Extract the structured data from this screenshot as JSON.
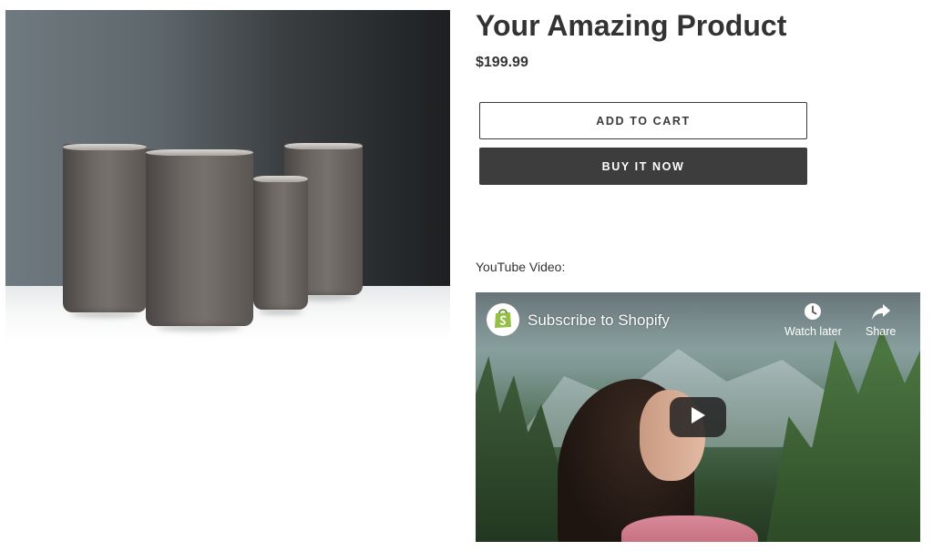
{
  "product": {
    "title": "Your Amazing Product",
    "price": "$199.99",
    "add_to_cart_label": "ADD TO CART",
    "buy_now_label": "BUY IT NOW"
  },
  "video_section": {
    "label": "YouTube Video:",
    "video_title": "Subscribe to Shopify",
    "watch_later_label": "Watch later",
    "share_label": "Share"
  },
  "icons": {
    "channel": "shopify-bag-icon",
    "watch_later": "clock-icon",
    "share": "share-arrow-icon",
    "play": "play-icon"
  },
  "colors": {
    "text": "#333333",
    "buy_button_bg": "#3d3d3d",
    "shopify_green": "#95bf47",
    "play_button_bg": "#212121"
  }
}
